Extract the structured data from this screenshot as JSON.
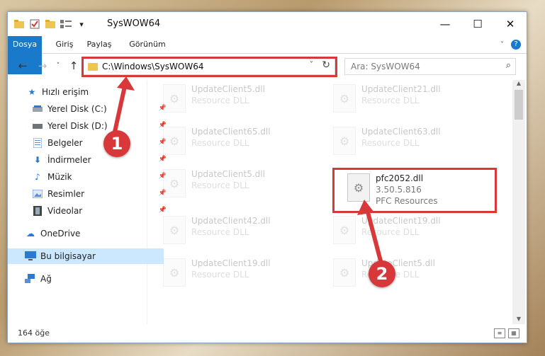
{
  "window": {
    "title": "SysWOW64"
  },
  "ribbon": {
    "tabs": [
      "Dosya",
      "Giriş",
      "Paylaş",
      "Görünüm"
    ]
  },
  "address": {
    "path": "C:\\Windows\\SysWOW64"
  },
  "search": {
    "placeholder": "Ara: SysWOW64"
  },
  "sidebar": {
    "quick_access": "Hızlı erişim",
    "items": [
      "Yerel Disk (C:)",
      "Yerel Disk (D:)",
      "Belgeler",
      "İndirmeler",
      "Müzik",
      "Resimler",
      "Videolar"
    ],
    "onedrive": "OneDrive",
    "this_pc": "Bu bilgisayar",
    "network": "Ağ"
  },
  "files": [
    {
      "name": "UpdateClient5.dll",
      "line2": "Resource DLL",
      "line3": ""
    },
    {
      "name": "UpdateClient21.dll",
      "line2": "Resource DLL",
      "line3": ""
    },
    {
      "name": "UpdateClient65.dll",
      "line2": "Resource DLL",
      "line3": ""
    },
    {
      "name": "UpdateClient63.dll",
      "line2": "Resource DLL",
      "line3": ""
    },
    {
      "name": "UpdateClient5.dll",
      "line2": "Resource DLL",
      "line3": ""
    },
    {
      "name": "pfc2052.dll",
      "line2": "3.50.5.816",
      "line3": "PFC Resources"
    },
    {
      "name": "UpdateClient42.dll",
      "line2": "Resource DLL",
      "line3": ""
    },
    {
      "name": "UpdateClient19.dll",
      "line2": "Resource DLL",
      "line3": ""
    },
    {
      "name": "UpdateClient19.dll",
      "line2": "Resource DLL",
      "line3": ""
    },
    {
      "name": "UpdateClient5.dll",
      "line2": "Resource DLL",
      "line3": ""
    }
  ],
  "status": {
    "item_count": "164 öğe"
  },
  "callouts": [
    "1",
    "2"
  ],
  "colors": {
    "accent": "#1979ca",
    "highlight": "#d9383a"
  }
}
